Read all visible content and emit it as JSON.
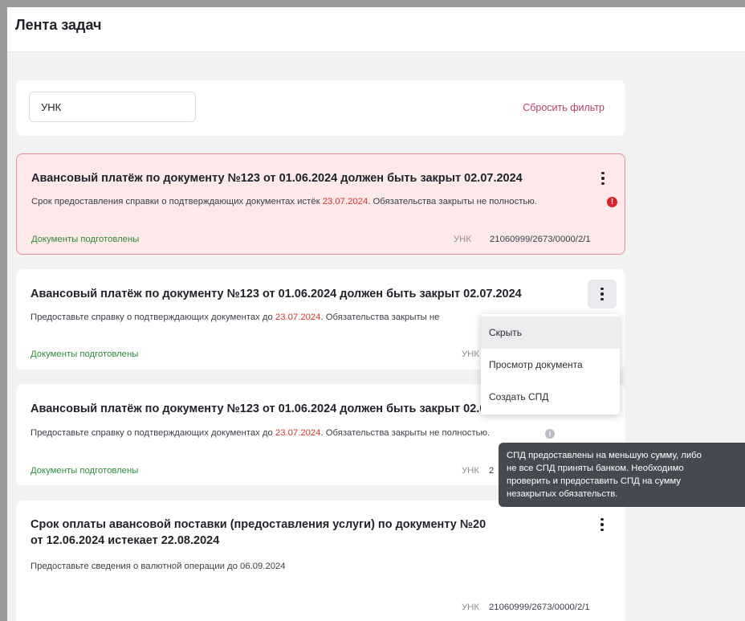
{
  "header": {
    "title": "Лента задач"
  },
  "filter": {
    "unk_value": "УНК",
    "reset_label": "Сбросить фильтр"
  },
  "tasks": [
    {
      "title": "Авансовый платёж по документу №123 от 01.06.2024 должен быть закрыт 02.07.2024",
      "desc_before": "Срок предоставления справки о подтверждающих документах истёк ",
      "desc_date": "23.07.2024",
      "desc_after": ". Обязательства закрыты не полностью.",
      "status": "Документы подготовлены",
      "unk_label": "УНК",
      "unk_value": "21060999/2673/0000/2/1",
      "state": "overdue"
    },
    {
      "title": "Авансовый платёж по документу №123 от 01.06.2024 должен быть закрыт 02.07.2024",
      "desc_before": "Предоставьте справку о подтверждающих документах до ",
      "desc_date": "23.07.2024",
      "desc_after": ". Обязательства закрыты не",
      "status": "Документы подготовлены",
      "unk_label": "УНК"
    },
    {
      "title": "Авансовый платёж по документу №123 от 01.06.2024 должен быть закрыт 02.07.20",
      "desc_before": "Предоставьте справку о подтверждающих документах до ",
      "desc_date": "23.07.2024",
      "desc_after": ". Обязательства закрыты не полностью.",
      "status": "Документы подготовлены",
      "unk_label": "УНК",
      "unk_value": "2"
    },
    {
      "title_line1": "Срок оплаты авансовой поставки (предоставления услуги) по документу №20",
      "title_line2": "от 12.06.2024 истекает 22.08.2024",
      "desc": "Предоставьте сведения о валютной операции до 06.09.2024",
      "unk_label": "УНК",
      "unk_value": "21060999/2673/0000/2/1"
    }
  ],
  "menu": {
    "items": [
      "Скрыть",
      "Просмотр документа",
      "Создать СПД"
    ]
  },
  "tooltip": {
    "lines": [
      "СПД предоставлены на меньшую сумму, либо",
      "не все СПД приняты банком. Необходимо",
      "проверить и предоставить СПД на сумму",
      "незакрытых обязательств."
    ]
  },
  "icons": {
    "kebab": "more-vertical-icon",
    "error": "error-icon",
    "info": "info-icon"
  },
  "colors": {
    "accent": "#b0416f",
    "danger": "#d2322d",
    "success": "#2e8a3a",
    "overdue_bg": "#fde8ea"
  }
}
